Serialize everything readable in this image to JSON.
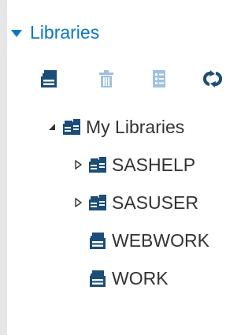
{
  "colors": {
    "accent": "#0a78c8",
    "icon_dark": "#1b4d78",
    "icon_muted": "#9fc1df",
    "text": "#333333"
  },
  "section": {
    "title": "Libraries",
    "expanded": true
  },
  "toolbar": {
    "buttons": [
      {
        "name": "new-library-button",
        "icon": "library-add-icon"
      },
      {
        "name": "delete-button",
        "icon": "trash-icon",
        "enabled": false
      },
      {
        "name": "properties-button",
        "icon": "properties-icon",
        "enabled": false
      },
      {
        "name": "refresh-button",
        "icon": "refresh-icon"
      }
    ]
  },
  "tree": {
    "root": {
      "label": "My Libraries",
      "icon": "libraries-group-icon",
      "expanded": true
    },
    "items": [
      {
        "label": "SASHELP",
        "icon": "libraries-group-icon",
        "expandable": true
      },
      {
        "label": "SASUSER",
        "icon": "libraries-group-icon",
        "expandable": true
      },
      {
        "label": "WEBWORK",
        "icon": "library-icon",
        "expandable": false
      },
      {
        "label": "WORK",
        "icon": "library-icon",
        "expandable": false
      }
    ]
  }
}
